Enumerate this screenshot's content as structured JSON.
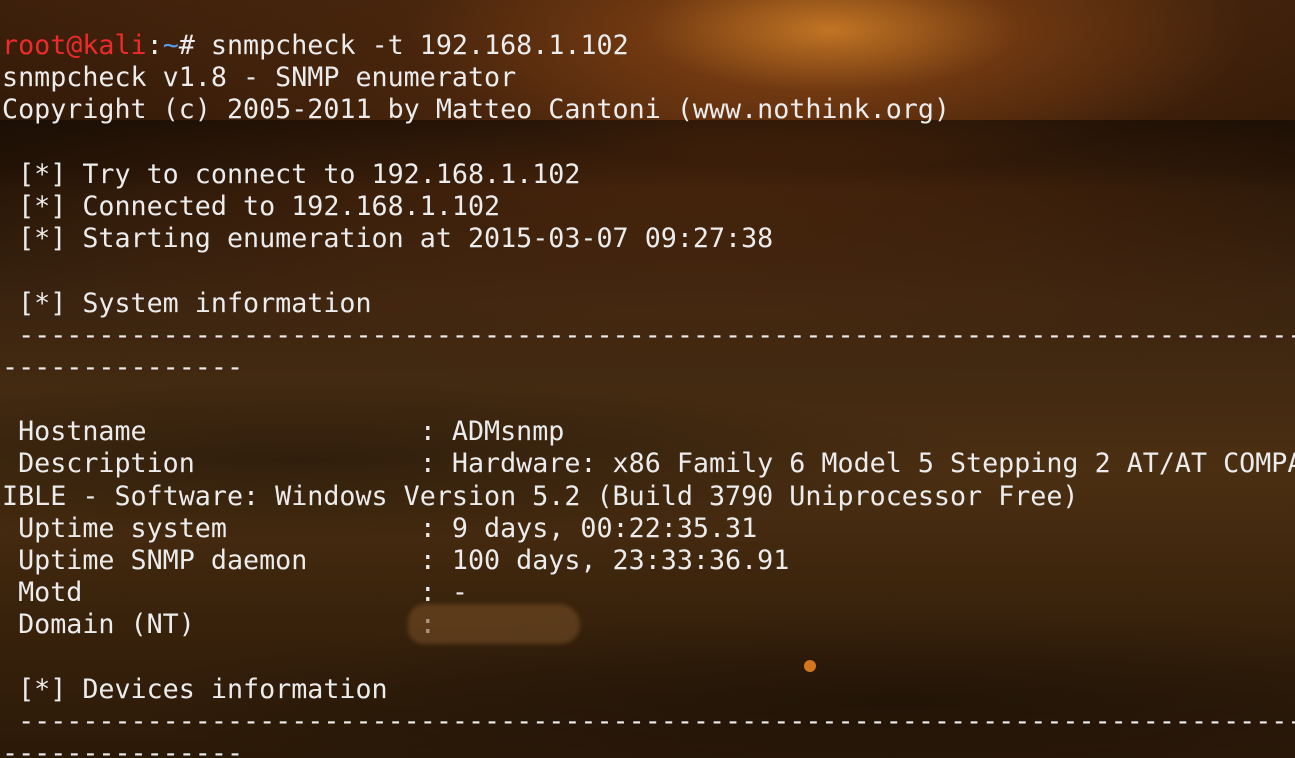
{
  "prompt": {
    "user_host": "root@kali",
    "separator": ":",
    "path": "~",
    "symbol": "# ",
    "command": "snmpcheck -t 192.168.1.102"
  },
  "banner": {
    "title": "snmpcheck v1.8 - SNMP enumerator",
    "copyright": "Copyright (c) 2005-2011 by Matteo Cantoni (www.nothink.org)"
  },
  "status": [
    " [*] Try to connect to 192.168.1.102",
    " [*] Connected to 192.168.1.102",
    " [*] Starting enumeration at 2015-03-07 09:27:38"
  ],
  "system_section": {
    "header": " [*] System information",
    "separator_line1": " ------------------------------------------------------------------------------------",
    "separator_line2": "---------------"
  },
  "system_info": {
    "hostname": " Hostname                 : ADMsnmp",
    "description_line1": " Description              : Hardware: x86 Family 6 Model 5 Stepping 2 AT/AT COMPAT",
    "description_line2": "IBLE - Software: Windows Version 5.2 (Build 3790 Uniprocessor Free)",
    "uptime_system": " Uptime system            : 9 days, 00:22:35.31",
    "uptime_snmp": " Uptime SNMP daemon       : 100 days, 23:33:36.91",
    "motd": " Motd                     : -",
    "domain": " Domain (NT)              : "
  },
  "devices_section": {
    "header": " [*] Devices information",
    "separator_line1": " ------------------------------------------------------------------------------------",
    "separator_line2": "---------------"
  }
}
